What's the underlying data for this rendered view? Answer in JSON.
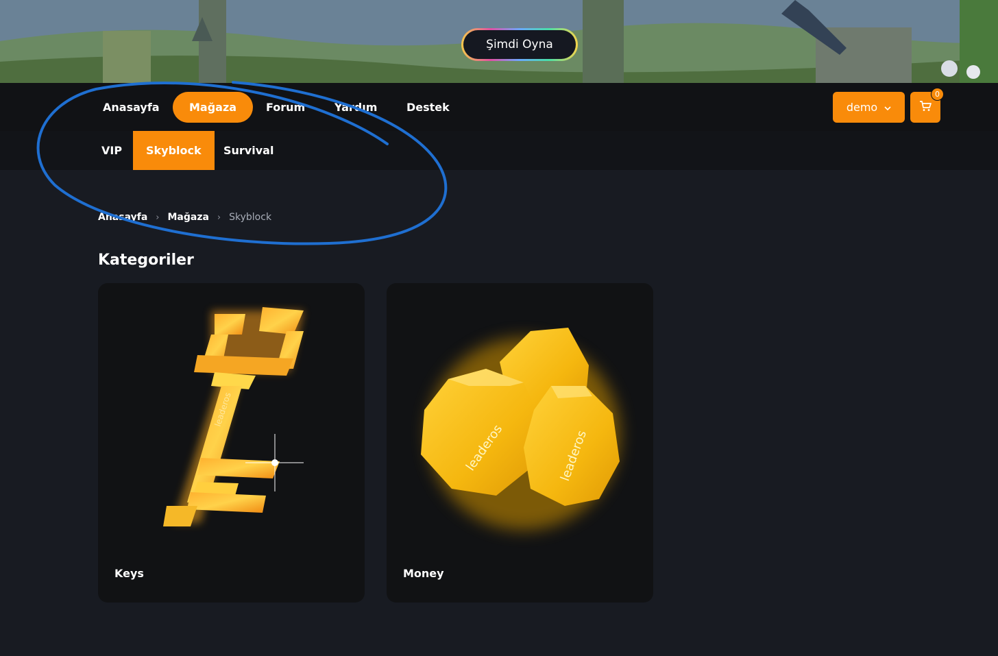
{
  "hero": {
    "play_button_label": "Şimdi Oyna"
  },
  "nav": {
    "items": [
      {
        "label": "Anasayfa",
        "active": false
      },
      {
        "label": "Mağaza",
        "active": true
      },
      {
        "label": "Forum",
        "active": false
      },
      {
        "label": "Yardım",
        "active": false
      },
      {
        "label": "Destek",
        "active": false
      }
    ],
    "user_label": "demo",
    "cart_count": "0"
  },
  "subnav": {
    "items": [
      {
        "label": "VIP",
        "active": false
      },
      {
        "label": "Skyblock",
        "active": true
      },
      {
        "label": "Survival",
        "active": false
      }
    ]
  },
  "breadcrumb": {
    "items": [
      "Anasayfa",
      "Mağaza"
    ],
    "current": "Skyblock"
  },
  "categories": {
    "title": "Kategoriler",
    "items": [
      {
        "label": "Keys",
        "icon": "golden-key-icon"
      },
      {
        "label": "Money",
        "icon": "gold-coins-icon"
      }
    ]
  },
  "colors": {
    "accent": "#f98b0a",
    "background": "#181b22",
    "navbar": "#111215",
    "annotation": "#1f6fd1"
  },
  "image_text": {
    "watermark": "leaderos"
  }
}
